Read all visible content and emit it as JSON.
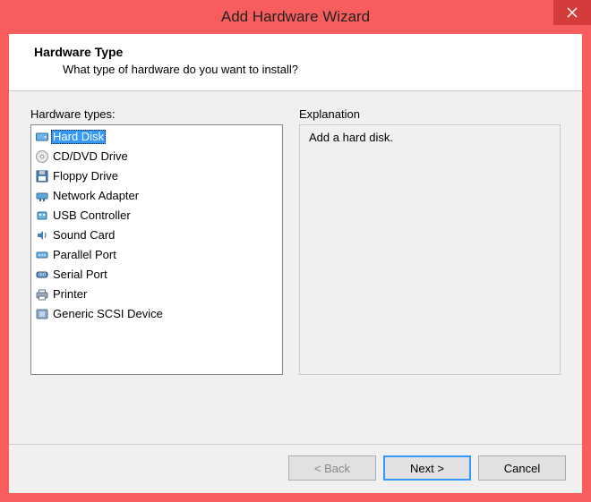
{
  "window": {
    "title": "Add Hardware Wizard"
  },
  "header": {
    "title": "Hardware Type",
    "subtitle": "What type of hardware do you want to install?"
  },
  "hardware_list": {
    "label": "Hardware types:",
    "items": [
      {
        "icon": "hard-disk-icon",
        "label": "Hard Disk",
        "selected": true
      },
      {
        "icon": "cd-dvd-icon",
        "label": "CD/DVD Drive",
        "selected": false
      },
      {
        "icon": "floppy-icon",
        "label": "Floppy Drive",
        "selected": false
      },
      {
        "icon": "network-icon",
        "label": "Network Adapter",
        "selected": false
      },
      {
        "icon": "usb-icon",
        "label": "USB Controller",
        "selected": false
      },
      {
        "icon": "sound-icon",
        "label": "Sound Card",
        "selected": false
      },
      {
        "icon": "parallel-icon",
        "label": "Parallel Port",
        "selected": false
      },
      {
        "icon": "serial-icon",
        "label": "Serial Port",
        "selected": false
      },
      {
        "icon": "printer-icon",
        "label": "Printer",
        "selected": false
      },
      {
        "icon": "scsi-icon",
        "label": "Generic SCSI Device",
        "selected": false
      }
    ]
  },
  "explanation": {
    "label": "Explanation",
    "text": "Add a hard disk."
  },
  "buttons": {
    "back": "< Back",
    "next": "Next >",
    "cancel": "Cancel"
  }
}
